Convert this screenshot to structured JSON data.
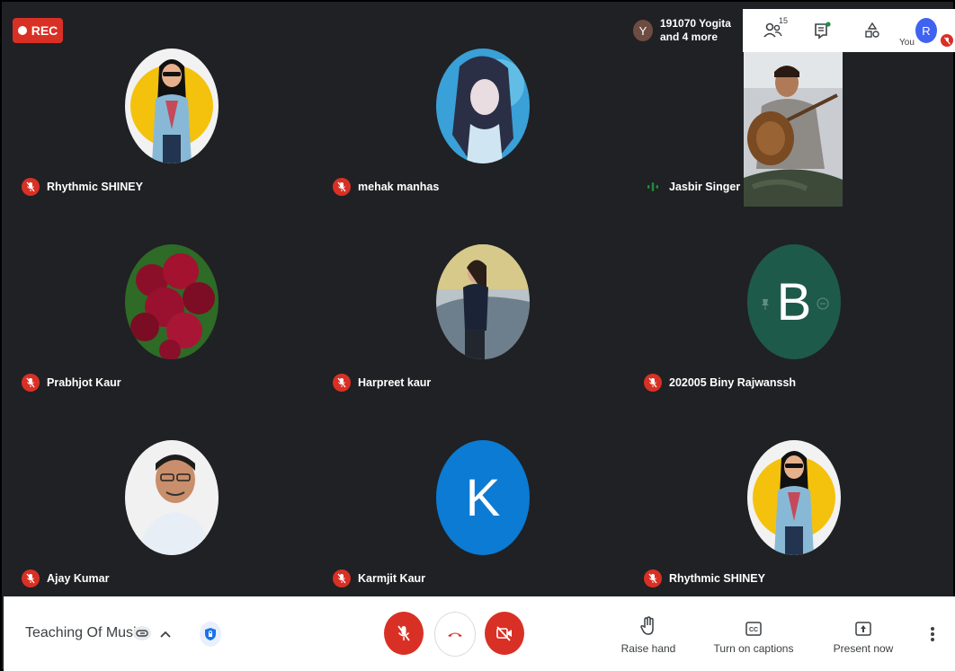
{
  "recording": {
    "label": "REC"
  },
  "participants": [
    {
      "name": "Rhythmic SHINEY",
      "avatar": "portrait-photo-yellow"
    },
    {
      "name": "mehak manhas",
      "avatar": "anime-girl-image"
    },
    {
      "name": "Jasbir Singer",
      "avatar": "live-video-sitar-player"
    },
    {
      "name": "Prabhjot Kaur",
      "avatar": "red-flowers-photo"
    },
    {
      "name": "Harpreet kaur",
      "avatar": "girl-by-car-photo"
    },
    {
      "name": "202005 Biny Rajwanssh",
      "initial": "B",
      "color": "#1e5a4a"
    },
    {
      "name": "Ajay Kumar",
      "avatar": "man-portrait-photo"
    },
    {
      "name": "Karmjit Kaur",
      "initial": "K",
      "color": "#0b7bd4"
    },
    {
      "name": "Rhythmic SHINEY",
      "avatar": "portrait-photo-yellow"
    }
  ],
  "top_bar": {
    "others_initial": "Y",
    "others_line1": "191070 Yogita",
    "others_line2": "and 4 more",
    "people_count": "15",
    "self_label": "You",
    "self_initial": "R"
  },
  "bottom_bar": {
    "meeting_title": "Teaching Of Music",
    "raise_hand_label": "Raise hand",
    "captions_label": "Turn on captions",
    "present_label": "Present now"
  },
  "colors": {
    "background": "#202124",
    "danger": "#d93025",
    "speaking": "#8ab4f8",
    "accent_blue": "#1a73e8"
  }
}
